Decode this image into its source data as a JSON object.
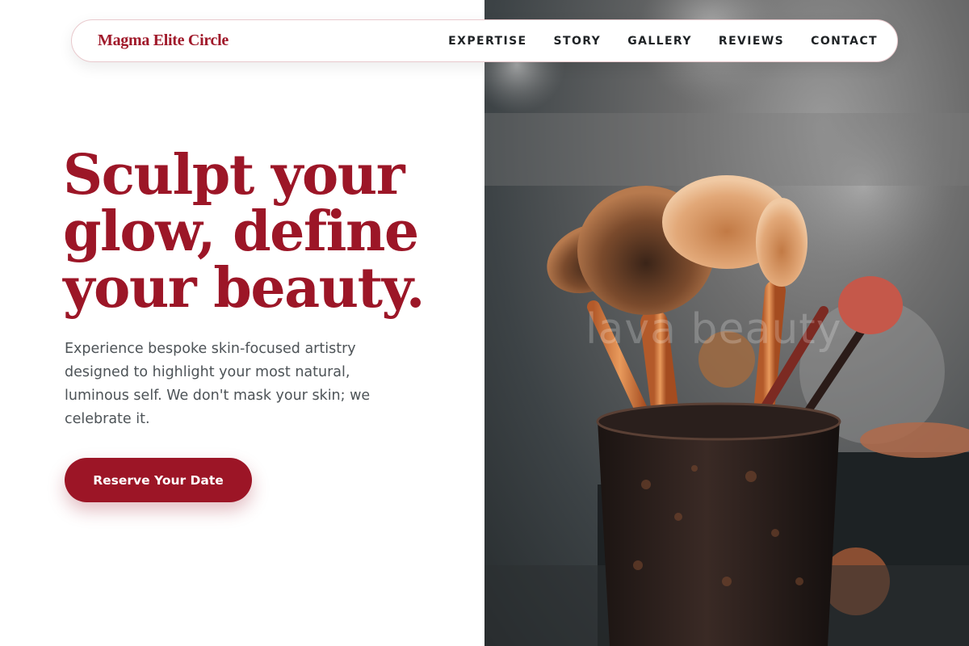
{
  "nav": {
    "brand": "Magma Elite Circle",
    "links": [
      "EXPERTISE",
      "STORY",
      "GALLERY",
      "REVIEWS",
      "CONTACT"
    ]
  },
  "hero": {
    "headline_lines": [
      "Sculpt your",
      "glow, define",
      "your beauty."
    ],
    "subtext": "Experience bespoke skin-focused artistry designed to highlight your most natural, luminous self. We don't mask your skin; we celebrate it.",
    "cta_label": "Reserve Your Date",
    "image_watermark": "lava beauty"
  },
  "colors": {
    "brand_red": "#9c1627",
    "text_dark": "#1f2326",
    "text_muted": "#4d5357"
  }
}
